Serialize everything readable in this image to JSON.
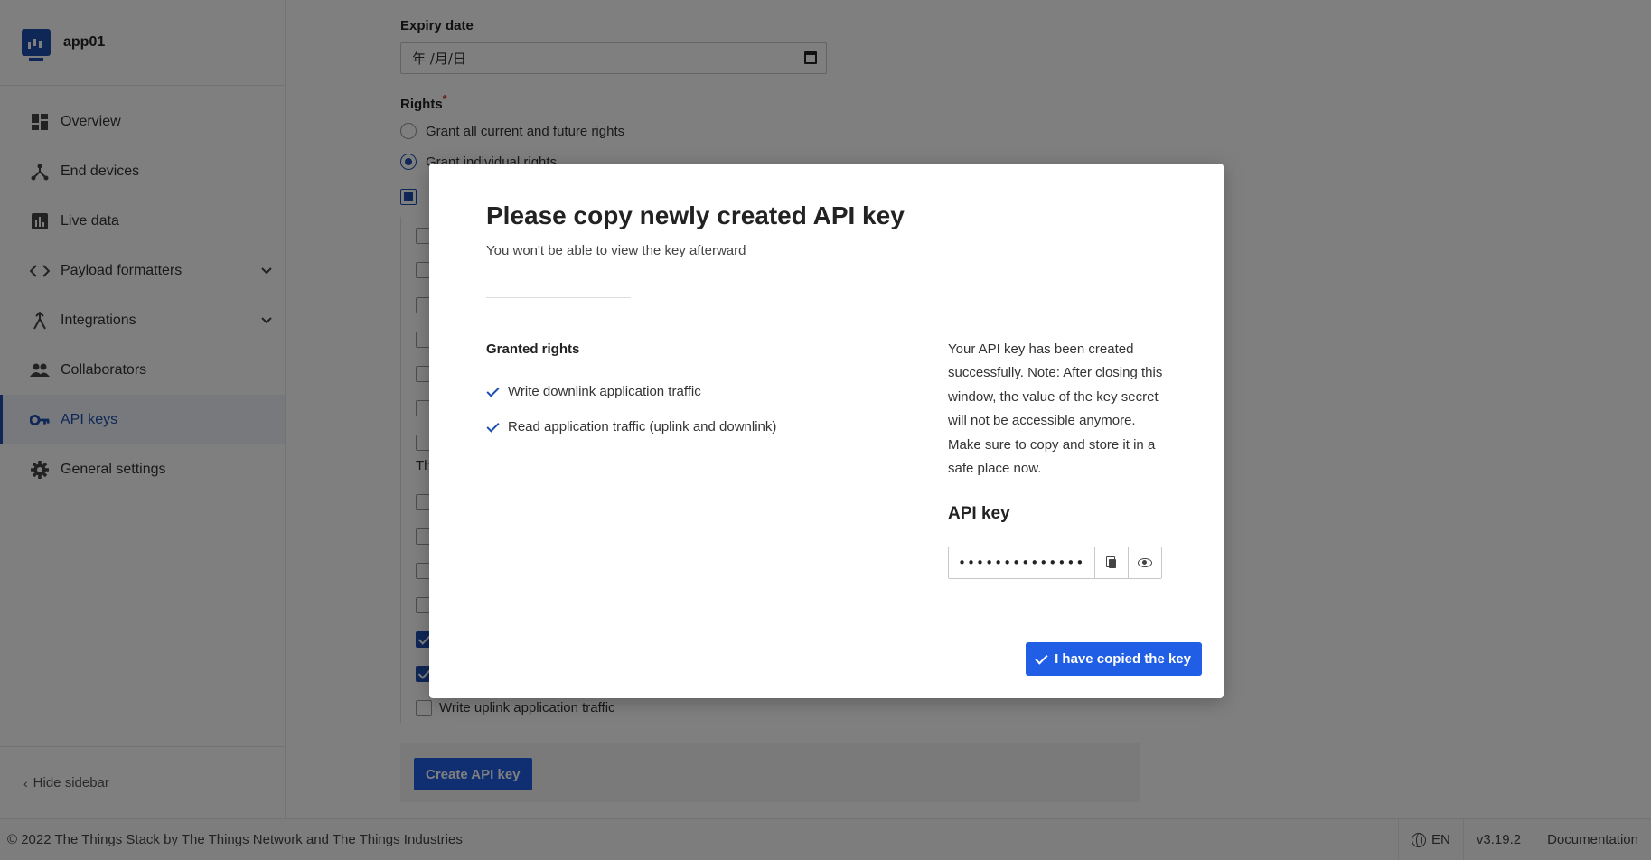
{
  "app": {
    "name": "app01"
  },
  "sidebar": {
    "items": [
      {
        "label": "Overview",
        "icon": "grid-icon"
      },
      {
        "label": "End devices",
        "icon": "fork-icon"
      },
      {
        "label": "Live data",
        "icon": "chart-icon"
      },
      {
        "label": "Payload formatters",
        "icon": "code-icon",
        "expandable": true
      },
      {
        "label": "Integrations",
        "icon": "merge-icon",
        "expandable": true
      },
      {
        "label": "Collaborators",
        "icon": "people-icon"
      },
      {
        "label": "API keys",
        "icon": "key-icon",
        "active": true
      },
      {
        "label": "General settings",
        "icon": "gear-icon"
      }
    ],
    "hide_label": "Hide sidebar"
  },
  "form": {
    "expiry_label": "Expiry date",
    "expiry_placeholder": "年 /月/日",
    "rights_label": "Rights",
    "required_mark": "*",
    "radio_all": "Grant all current and future rights",
    "radio_individual": "Grant individual rights",
    "partial_text": "Th",
    "last_checkbox_label": "Write uplink application traffic",
    "submit_label": "Create API key"
  },
  "modal": {
    "title": "Please copy newly created API key",
    "subtitle": "You won't be able to view the key afterward",
    "granted_title": "Granted rights",
    "granted_rights": [
      "Write downlink application traffic",
      "Read application traffic (uplink and downlink)"
    ],
    "note": "Your API key has been created successfully. Note: After closing this window, the value of the key secret will not be accessible anymore. Make sure to copy and store it in a safe place now.",
    "key_title": "API key",
    "key_masked": "••••••••••••••••",
    "confirm_label": "I have copied the key"
  },
  "footer": {
    "copyright": "© 2022 The Things Stack by The Things Network and The Things Industries",
    "language": "EN",
    "version": "v3.19.2",
    "docs": "Documentation"
  },
  "colors": {
    "accent": "#1f5ee5",
    "brand": "#1f4fae"
  }
}
